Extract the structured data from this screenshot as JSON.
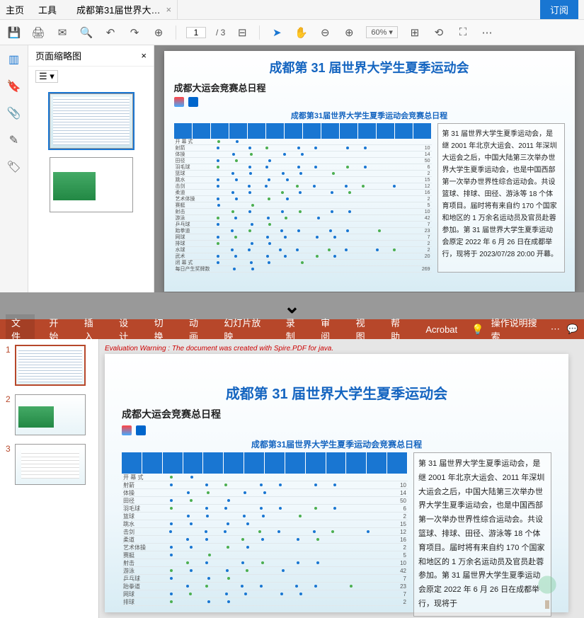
{
  "pdf": {
    "menu": {
      "home": "主页",
      "tools": "工具"
    },
    "tab_title": "成都第31届世界大…",
    "subscribe": "订阅",
    "page_current": "1",
    "page_total": "/ 3",
    "zoom": "60%",
    "thumbs_header": "页面缩略图",
    "thumbs_close": "×"
  },
  "doc": {
    "title": "成都第 31 届世界大学生夏季运动会",
    "subtitle": "成都大运会竞赛总日程",
    "sched_title": "成都第31届世界大学生夏季运动会竞赛总日程",
    "rows": [
      {
        "label": "开 幕 式",
        "end": ""
      },
      {
        "label": "射箭",
        "end": "10"
      },
      {
        "label": "体操",
        "end": "14"
      },
      {
        "label": "田径",
        "end": "50"
      },
      {
        "label": "羽毛球",
        "end": "6"
      },
      {
        "label": "篮球",
        "end": "2"
      },
      {
        "label": "跳水",
        "end": "15"
      },
      {
        "label": "击剑",
        "end": "12"
      },
      {
        "label": "柔道",
        "end": "16"
      },
      {
        "label": "艺术体操",
        "end": "2"
      },
      {
        "label": "赛艇",
        "end": "5"
      },
      {
        "label": "射击",
        "end": "10"
      },
      {
        "label": "游泳",
        "end": "42"
      },
      {
        "label": "乒乓球",
        "end": "7"
      },
      {
        "label": "跆拳道",
        "end": "23"
      },
      {
        "label": "网球",
        "end": "7"
      },
      {
        "label": "排球",
        "end": "2"
      },
      {
        "label": "水球",
        "end": "2"
      },
      {
        "label": "武术",
        "end": "20"
      },
      {
        "label": "闭 幕 式",
        "end": ""
      },
      {
        "label": "每日产生奖牌数",
        "end": "269"
      }
    ],
    "paragraph": "第 31 届世界大学生夏季运动会，是继 2001 年北京大运会、2011 年深圳大运会之后，中国大陆第三次举办世界大学生夏季运动会，也是中国西部第一次举办世界性综合运动会。共设篮球、排球、田径、游泳等 18 个体育项目。届时将有来自约 170 个国家和地区的 1 万余名运动员及官员赴蓉参加。第 31 届世界大学生夏季运动会原定 2022 年 6 月 26 日在成都举行，现将于 2023/07/28 20:00 开幕。",
    "paragraph_ppt": "第 31 届世界大学生夏季运动会，是继 2001 年北京大运会、2011 年深圳大运会之后，中国大陆第三次举办世界大学生夏季运动会，也是中国西部第一次举办世界性综合运动会。共设篮球、排球、田径、游泳等 18 个体育项目。届时将有来自约 170 个国家和地区的 1 万余名运动员及官员赴蓉参加。第 31 届世界大学生夏季运动会原定 2022 年 6 月 26 日在成都举行，现将于"
  },
  "ppt": {
    "tabs": {
      "file": "文件",
      "home": "开始",
      "insert": "插入",
      "design": "设计",
      "transition": "切换",
      "animation": "动画",
      "slideshow": "幻灯片放映",
      "record": "录制",
      "review": "审阅",
      "view": "视图",
      "help": "帮助",
      "acrobat": "Acrobat",
      "tell_me": "操作说明搜索"
    },
    "eval_warning": "Evaluation Warning : The document was created with Spire.PDF for java.",
    "slide_nums": [
      "1",
      "2",
      "3"
    ]
  }
}
